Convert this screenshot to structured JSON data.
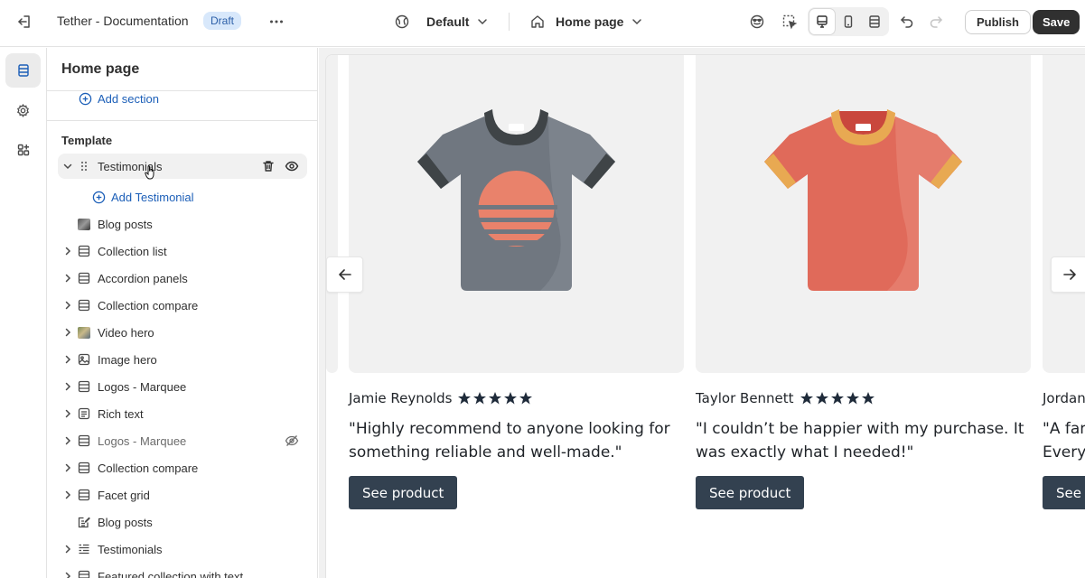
{
  "topbar": {
    "app_title": "Tether - Documentation",
    "draft_badge": "Draft",
    "theme_select": "Default",
    "page_select": "Home page",
    "publish_label": "Publish",
    "save_label": "Save"
  },
  "sidebar": {
    "title": "Home page",
    "add_section_label": "Add section",
    "template_label": "Template",
    "add_testimonial_label": "Add Testimonial",
    "items": [
      {
        "label": "Testimonials",
        "icon": "drag-handle-icon",
        "expanded": true,
        "hover": true
      },
      {
        "label": "Blog posts",
        "icon": "image-thumbnail"
      },
      {
        "label": "Collection list",
        "icon": "section-layout-icon"
      },
      {
        "label": "Accordion panels",
        "icon": "section-layout-icon"
      },
      {
        "label": "Collection compare",
        "icon": "section-layout-icon"
      },
      {
        "label": "Video hero",
        "icon": "video-thumbnail"
      },
      {
        "label": "Image hero",
        "icon": "image-icon"
      },
      {
        "label": "Logos - Marquee",
        "icon": "section-layout-icon"
      },
      {
        "label": "Rich text",
        "icon": "text-block-icon"
      },
      {
        "label": "Logos - Marquee",
        "icon": "section-layout-icon",
        "hidden": true
      },
      {
        "label": "Collection compare",
        "icon": "section-layout-icon"
      },
      {
        "label": "Facet grid",
        "icon": "section-layout-icon"
      },
      {
        "label": "Blog posts",
        "icon": "blog-edit-icon"
      },
      {
        "label": "Testimonials",
        "icon": "list-icon"
      },
      {
        "label": "Featured collection with text",
        "icon": "section-layout-icon"
      }
    ]
  },
  "preview": {
    "cards": [
      {
        "name": "Jamie Reynolds",
        "rating": 5,
        "quote": "\"Highly recommend to anyone looking for something reliable and well-made.\"",
        "button": "See product",
        "shirt_color": "#707780",
        "accent": "#e9826b"
      },
      {
        "name": "Taylor Bennett",
        "rating": 5,
        "quote": "\"I couldn’t be happier with my purchase. It was exactly what I needed!\"",
        "button": "See product",
        "shirt_color": "#e06a5a",
        "accent": "#e8a952"
      },
      {
        "name": "Jordan",
        "quote": "\"A fan",
        "quote_line2": "Every",
        "button": "See"
      }
    ]
  },
  "colors": {
    "accent_link": "#1c5fb8",
    "button_dark": "#334150",
    "save_bg": "#303030"
  }
}
